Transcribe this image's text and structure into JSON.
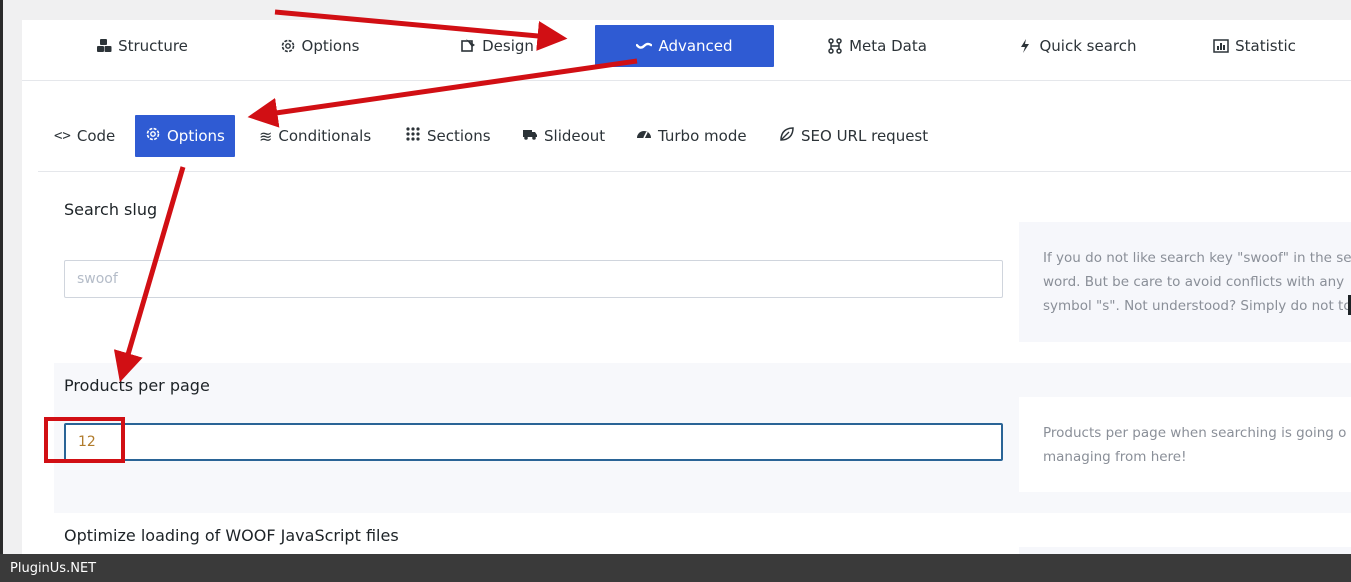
{
  "top_tabs": [
    {
      "label": "Structure",
      "icon": "cubes-icon"
    },
    {
      "label": "Options",
      "icon": "gear-icon"
    },
    {
      "label": "Design",
      "icon": "paint-icon"
    },
    {
      "label": "Advanced",
      "icon": "wave-icon",
      "active": true
    },
    {
      "label": "Meta Data",
      "icon": "network-icon"
    },
    {
      "label": "Quick search",
      "icon": "bolt-icon"
    },
    {
      "label": "Statistic",
      "icon": "bar-chart-icon"
    }
  ],
  "sub_tabs": [
    {
      "label": "Code",
      "icon": "code-icon"
    },
    {
      "label": "Options",
      "icon": "gear-icon",
      "active": true
    },
    {
      "label": "Conditionals",
      "icon": "waves-icon"
    },
    {
      "label": "Sections",
      "icon": "grid-icon"
    },
    {
      "label": "Slideout",
      "icon": "truck-icon"
    },
    {
      "label": "Turbo mode",
      "icon": "gauge-icon"
    },
    {
      "label": "SEO URL request",
      "icon": "leaf-icon"
    }
  ],
  "search_slug": {
    "label": "Search slug",
    "placeholder": "swoof",
    "help": [
      "If you do not like search key \"swoof\" in the se",
      "word. But be care to avoid conflicts with any",
      "symbol \"s\". Not understood? Simply do not to"
    ]
  },
  "products_per_page": {
    "label": "Products per page",
    "value": "12",
    "help": [
      "Products per page when searching is going o",
      "managing from here!"
    ]
  },
  "optimize": {
    "label": "Optimize loading of WOOF JavaScript files"
  },
  "footer": {
    "text": "PluginUs.NET"
  },
  "colors": {
    "accent": "#2f5bd3",
    "annotation": "#d10f14"
  }
}
